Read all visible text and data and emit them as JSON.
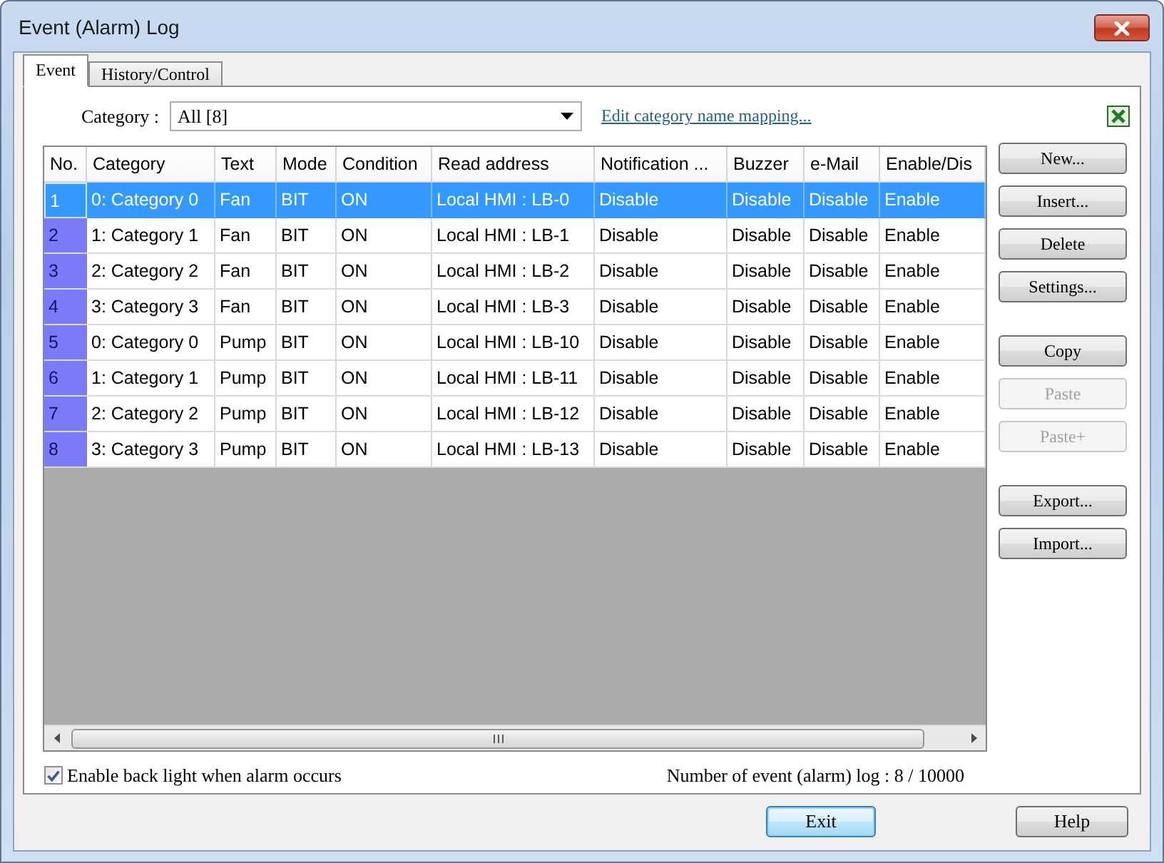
{
  "window": {
    "title": "Event (Alarm) Log"
  },
  "tabs": [
    {
      "label": "Event",
      "selected": true
    },
    {
      "label": "History/Control",
      "selected": false
    }
  ],
  "category_filter": {
    "label": "Category :",
    "value": "All [8]"
  },
  "mapping_link": {
    "label": "Edit category name mapping..."
  },
  "table": {
    "columns": [
      "No.",
      "Category",
      "Text",
      "Mode",
      "Condition",
      "Read address",
      "Notification ...",
      "Buzzer",
      "e-Mail",
      "Enable/Dis"
    ],
    "rows": [
      {
        "selected": true,
        "cells": [
          "1",
          "0: Category 0",
          "Fan",
          "BIT",
          "ON",
          "Local HMI : LB-0",
          "Disable",
          "Disable",
          "Disable",
          "Enable"
        ]
      },
      {
        "selected": false,
        "cells": [
          "2",
          "1: Category 1",
          "Fan",
          "BIT",
          "ON",
          "Local HMI : LB-1",
          "Disable",
          "Disable",
          "Disable",
          "Enable"
        ]
      },
      {
        "selected": false,
        "cells": [
          "3",
          "2: Category 2",
          "Fan",
          "BIT",
          "ON",
          "Local HMI : LB-2",
          "Disable",
          "Disable",
          "Disable",
          "Enable"
        ]
      },
      {
        "selected": false,
        "cells": [
          "4",
          "3: Category 3",
          "Fan",
          "BIT",
          "ON",
          "Local HMI : LB-3",
          "Disable",
          "Disable",
          "Disable",
          "Enable"
        ]
      },
      {
        "selected": false,
        "cells": [
          "5",
          "0: Category 0",
          "Pump",
          "BIT",
          "ON",
          "Local HMI : LB-10",
          "Disable",
          "Disable",
          "Disable",
          "Enable"
        ]
      },
      {
        "selected": false,
        "cells": [
          "6",
          "1: Category 1",
          "Pump",
          "BIT",
          "ON",
          "Local HMI : LB-11",
          "Disable",
          "Disable",
          "Disable",
          "Enable"
        ]
      },
      {
        "selected": false,
        "cells": [
          "7",
          "2: Category 2",
          "Pump",
          "BIT",
          "ON",
          "Local HMI : LB-12",
          "Disable",
          "Disable",
          "Disable",
          "Enable"
        ]
      },
      {
        "selected": false,
        "cells": [
          "8",
          "3: Category 3",
          "Pump",
          "BIT",
          "ON",
          "Local HMI : LB-13",
          "Disable",
          "Disable",
          "Disable",
          "Enable"
        ]
      }
    ]
  },
  "side_button_groups": [
    {
      "buttons": [
        {
          "label": "New...",
          "disabled": false
        },
        {
          "label": "Insert...",
          "disabled": false
        },
        {
          "label": "Delete",
          "disabled": false
        },
        {
          "label": "Settings...",
          "disabled": false
        }
      ]
    },
    {
      "buttons": [
        {
          "label": "Copy",
          "disabled": false
        },
        {
          "label": "Paste",
          "disabled": true
        },
        {
          "label": "Paste+",
          "disabled": true
        }
      ]
    },
    {
      "buttons": [
        {
          "label": "Export...",
          "disabled": false
        },
        {
          "label": "Import...",
          "disabled": false
        }
      ]
    }
  ],
  "backlight_option": {
    "label": "Enable back light when alarm occurs",
    "checked": true
  },
  "log_count": "Number of event (alarm) log : 8 / 10000",
  "footer_buttons": [
    {
      "label": "Exit",
      "focused": true
    },
    {
      "label": "Help",
      "focused": false
    }
  ]
}
